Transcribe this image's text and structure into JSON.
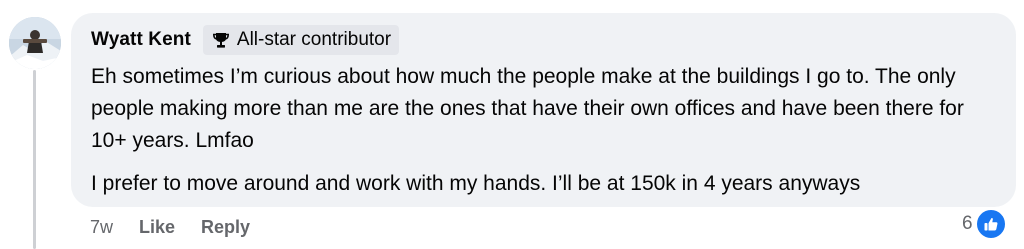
{
  "comment": {
    "author": "Wyatt Kent",
    "badge": {
      "icon": "trophy-icon",
      "label": "All-star contributor"
    },
    "paragraphs": [
      "Eh sometimes I’m curious about how much the people make at the buildings I go to. The only people making more than me are the ones that have their own offices and have been there for 10+ years. Lmfao",
      "I prefer to move around and work with my hands. I’ll be at 150k in 4 years anyways"
    ]
  },
  "actions": {
    "timestamp": "7w",
    "like_label": "Like",
    "reply_label": "Reply"
  },
  "reactions": {
    "count": "6",
    "icon": "thumbs-up-icon"
  },
  "colors": {
    "bubble": "#f0f2f5",
    "badge_bg": "#e4e6eb",
    "secondary_text": "#65676b",
    "like_blue": "#1877f2",
    "thread_line": "#ced0d4"
  }
}
